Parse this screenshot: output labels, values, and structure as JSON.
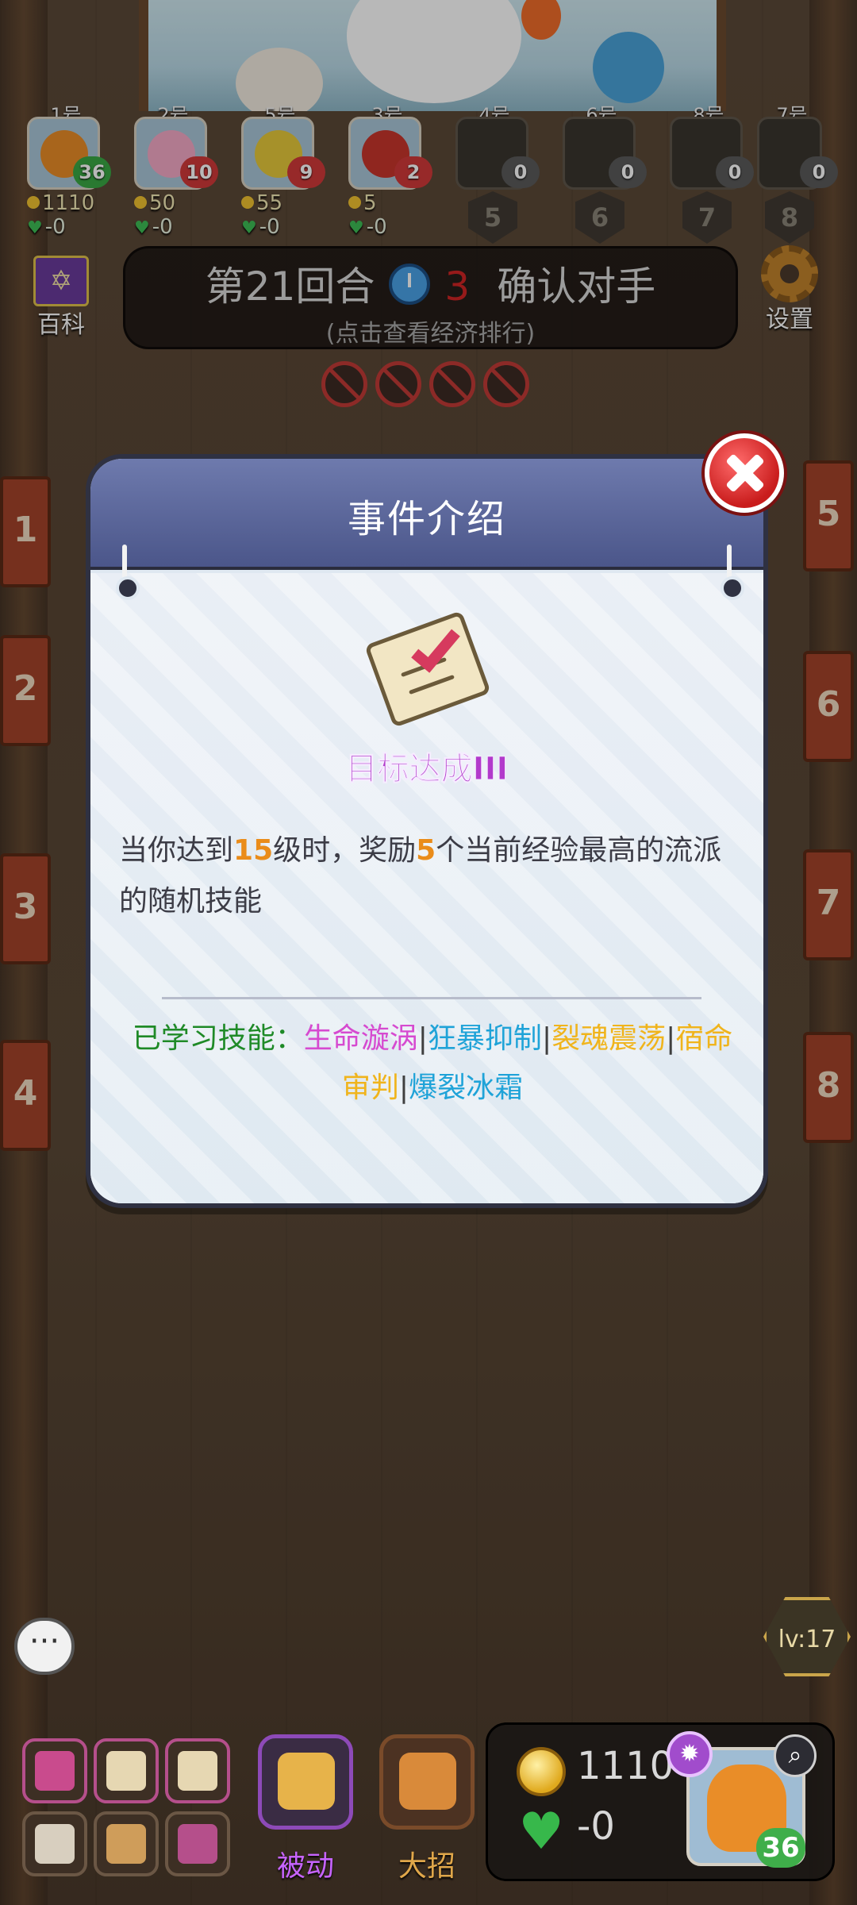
{
  "players": [
    {
      "num": "1号",
      "count": "36",
      "gold": "1110",
      "hp": "-0",
      "active": true,
      "color": "#e98d28",
      "count_color": "#39a844"
    },
    {
      "num": "2号",
      "count": "10",
      "gold": "50",
      "hp": "-0",
      "active": true,
      "color": "#f4a9c6",
      "count_color": "#d23a3a"
    },
    {
      "num": "5号",
      "count": "9",
      "gold": "55",
      "hp": "-0",
      "active": true,
      "color": "#e7c93b",
      "count_color": "#d23a3a"
    },
    {
      "num": "3号",
      "count": "2",
      "gold": "5",
      "hp": "-0",
      "active": true,
      "color": "#c8352c",
      "count_color": "#d23a3a"
    },
    {
      "num": "4号",
      "count": "0",
      "shield": "5",
      "active": false,
      "count_color": "#5a5a5a"
    },
    {
      "num": "6号",
      "count": "0",
      "shield": "6",
      "active": false,
      "count_color": "#5a5a5a"
    },
    {
      "num": "8号",
      "count": "0",
      "shield": "7",
      "active": false,
      "count_color": "#5a5a5a"
    },
    {
      "num": "7号",
      "count": "0",
      "shield": "8",
      "active": false,
      "count_color": "#5a5a5a"
    }
  ],
  "topbar": {
    "encyclopedia_label": "百科",
    "round_label": "第21回合",
    "countdown": "3",
    "phase": "确认对手",
    "hint": "(点击查看经济排行)",
    "settings_label": "设置"
  },
  "modal": {
    "title": "事件介绍",
    "event_name": "目标达成III",
    "desc_part1": "当你达到",
    "desc_level": "15",
    "desc_part2": "级时，奖励",
    "desc_count": "5",
    "desc_part3": "个当前经验最高的流派的随机技能",
    "learned_label": "已学习技能：",
    "skills": [
      {
        "name": "生命漩涡",
        "color": "#d64ad0"
      },
      {
        "name": "狂暴抑制",
        "color": "#1fa3d8"
      },
      {
        "name": "裂魂震荡",
        "color": "#f0b41c"
      },
      {
        "name": "宿命审判",
        "color": "#f0b41c"
      },
      {
        "name": "爆裂冰霜",
        "color": "#1fa3d8"
      }
    ],
    "separator": "|"
  },
  "hud": {
    "passive_label": "被动",
    "ultimate_label": "大招",
    "gold": "1110",
    "hp": "-0",
    "hero_count": "36",
    "level": "lv:17",
    "chat_glyph": "···"
  },
  "side_numbers_left": [
    "1",
    "2",
    "3",
    "4"
  ],
  "side_numbers_right": [
    "5",
    "6",
    "7",
    "8"
  ]
}
